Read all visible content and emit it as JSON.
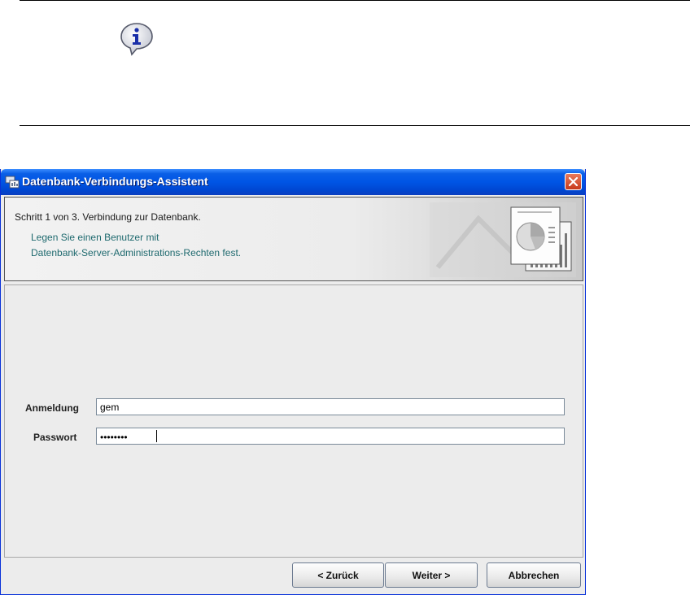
{
  "dialog": {
    "title": "Datenbank-Verbindungs-Assistent",
    "header": {
      "step": "Schritt 1 von 3. Verbindung zur Datenbank.",
      "description_line1": "Legen Sie einen Benutzer mit",
      "description_line2": "Datenbank-Server-Administrations-Rechten fest."
    },
    "form": {
      "login_label": "Anmeldung",
      "login_value": "gem",
      "password_label": "Passwort",
      "password_mask": "••••••••"
    },
    "buttons": {
      "back": "< Zurück",
      "next": "Weiter >",
      "cancel": "Abbrechen"
    }
  },
  "icons": {
    "info": "info-icon",
    "app": "database-wizard-icon",
    "close": "close-icon"
  },
  "colors": {
    "titlebar": "#0055e5",
    "description_text": "#1f6a6f",
    "close_button": "#c7391a"
  }
}
